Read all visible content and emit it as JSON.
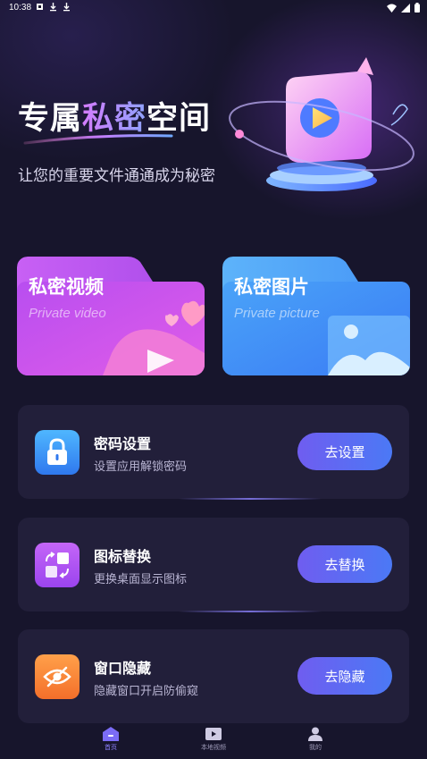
{
  "status_bar": {
    "time": "10:38"
  },
  "hero": {
    "title_part1": "专属",
    "title_part2": "私密",
    "title_part3": "空间",
    "subtitle": "让您的重要文件通通成为秘密"
  },
  "folders": [
    {
      "title": "私密视频",
      "subtitle": "Private video"
    },
    {
      "title": "私密图片",
      "subtitle": "Private picture"
    }
  ],
  "cards": [
    {
      "title": "密码设置",
      "desc": "设置应用解锁密码",
      "button": "去设置",
      "icon": "lock-icon"
    },
    {
      "title": "图标替换",
      "desc": "更换桌面显示图标",
      "button": "去替换",
      "icon": "icon-swap-icon"
    },
    {
      "title": "窗口隐藏",
      "desc": "隐藏窗口开启防偷窥",
      "button": "去隐藏",
      "icon": "eye-hidden-icon"
    }
  ],
  "tabs": [
    {
      "label": "首页",
      "icon": "home-icon"
    },
    {
      "label": "本地视频",
      "icon": "video-icon"
    },
    {
      "label": "我的",
      "icon": "user-icon"
    }
  ],
  "colors": {
    "background": "#17152c",
    "card": "#221f3a",
    "button_start": "#6f5df0",
    "button_end": "#4b79f5",
    "folder_video": "#c04cf0",
    "folder_picture": "#3d8cf7"
  }
}
